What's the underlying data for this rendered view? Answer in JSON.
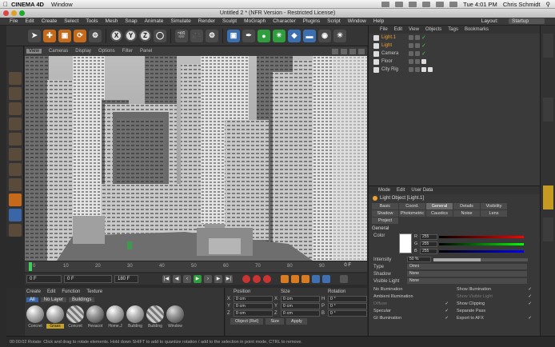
{
  "macbar": {
    "app_name": "CINEMA 4D",
    "menu": [
      "Window"
    ],
    "clock": "Tue 4:01 PM",
    "user": "Chris Schmidt"
  },
  "window_title": "Untitled 2 * (NFR Version - Restricted License)",
  "app_menu": [
    "File",
    "Edit",
    "Create",
    "Select",
    "Tools",
    "Mesh",
    "Snap",
    "Animate",
    "Simulate",
    "Render",
    "Sculpt",
    "MoGraph",
    "Character",
    "Plugins",
    "Script",
    "Window",
    "Help"
  ],
  "layout": {
    "label": "Layout:",
    "value": "Startup"
  },
  "toolbar_axes": [
    "X",
    "Y",
    "Z"
  ],
  "viewport": {
    "menu": [
      "View",
      "Cameras",
      "Display",
      "Options",
      "Filter",
      "Panel"
    ],
    "active_tab": "Perspective"
  },
  "timeline": {
    "ticks": [
      "0",
      "10",
      "20",
      "30",
      "40",
      "50",
      "60",
      "70",
      "80",
      "90"
    ],
    "current_frame": "0 F"
  },
  "transport": {
    "start": "0 F",
    "field2": "0 F",
    "end": "180 F"
  },
  "material_manager": {
    "menu": [
      "Create",
      "Edit",
      "Function",
      "Texture"
    ],
    "filters": [
      "All",
      "No Layer",
      "Buildings"
    ],
    "materials": [
      "Concret",
      "Grass",
      "Concret",
      "Hexacot",
      "Home.J",
      "Building",
      "Building",
      "Window"
    ]
  },
  "coordinates": {
    "headers": [
      "Position",
      "Size",
      "Rotation"
    ],
    "rows": [
      {
        "axis": "X",
        "pos": "0 cm",
        "size_axis": "X",
        "size": "0 cm",
        "rot_axis": "H",
        "rot": "0 °"
      },
      {
        "axis": "Y",
        "pos": "0 cm",
        "size_axis": "Y",
        "size": "0 cm",
        "rot_axis": "P",
        "rot": "0 °"
      },
      {
        "axis": "Z",
        "pos": "0 cm",
        "size_axis": "Z",
        "size": "0 cm",
        "rot_axis": "B",
        "rot": "0 °"
      }
    ],
    "mode": "Object (Rel)",
    "size_mode": "Size",
    "apply": "Apply"
  },
  "status_text": "00:00:02   Rotate: Click and drag to rotate elements. Hold down SHIFT to add to quantize rotation / add to the selection in point mode, CTRL to remove.",
  "objects": {
    "menu": [
      "File",
      "Edit",
      "View",
      "Objects",
      "Tags",
      "Bookmarks"
    ],
    "items": [
      {
        "name": "Light.1",
        "type": "light"
      },
      {
        "name": "Light",
        "type": "light"
      },
      {
        "name": "Camera",
        "type": "camera"
      },
      {
        "name": "Floor",
        "type": "floor"
      },
      {
        "name": "City Rig",
        "type": "null"
      }
    ]
  },
  "attributes": {
    "menu": [
      "Mode",
      "Edit",
      "User Data"
    ],
    "title": "Light Object [Light.1]",
    "tabs": [
      "Basic",
      "Coord.",
      "General",
      "Details",
      "Visibility",
      "Shadow",
      "Photometric",
      "Caustics",
      "Noise",
      "Lens",
      "Project"
    ],
    "active_tab": "General",
    "section": "General",
    "color_label": "Color",
    "rgb": [
      {
        "ch": "R",
        "val": "255"
      },
      {
        "ch": "G",
        "val": "255"
      },
      {
        "ch": "B",
        "val": "255"
      }
    ],
    "intensity_label": "Intensity",
    "intensity": "50 %",
    "intensity_fraction": 0.5,
    "type_label": "Type",
    "type": "Omni",
    "shadow_label": "Shadow",
    "shadow": "None",
    "visible_light_label": "Visible Light",
    "visible_light": "None",
    "checks": [
      {
        "label": "No Illumination",
        "checked": "",
        "dim": false
      },
      {
        "label": "Show Illumination",
        "checked": "✓",
        "dim": false
      },
      {
        "label": "Ambient Illumination",
        "checked": "",
        "dim": false
      },
      {
        "label": "Show Visible Light",
        "checked": "✓",
        "dim": true
      },
      {
        "label": "Diffuse",
        "checked": "✓",
        "dim": true
      },
      {
        "label": "Show Clipping",
        "checked": "✓",
        "dim": false
      },
      {
        "label": "Specular",
        "checked": "✓",
        "dim": false
      },
      {
        "label": "Separate Pass",
        "checked": "",
        "dim": false
      },
      {
        "label": "GI Illumination",
        "checked": "✓",
        "dim": false
      },
      {
        "label": "Export to AFX",
        "checked": "✓",
        "dim": false
      }
    ]
  }
}
